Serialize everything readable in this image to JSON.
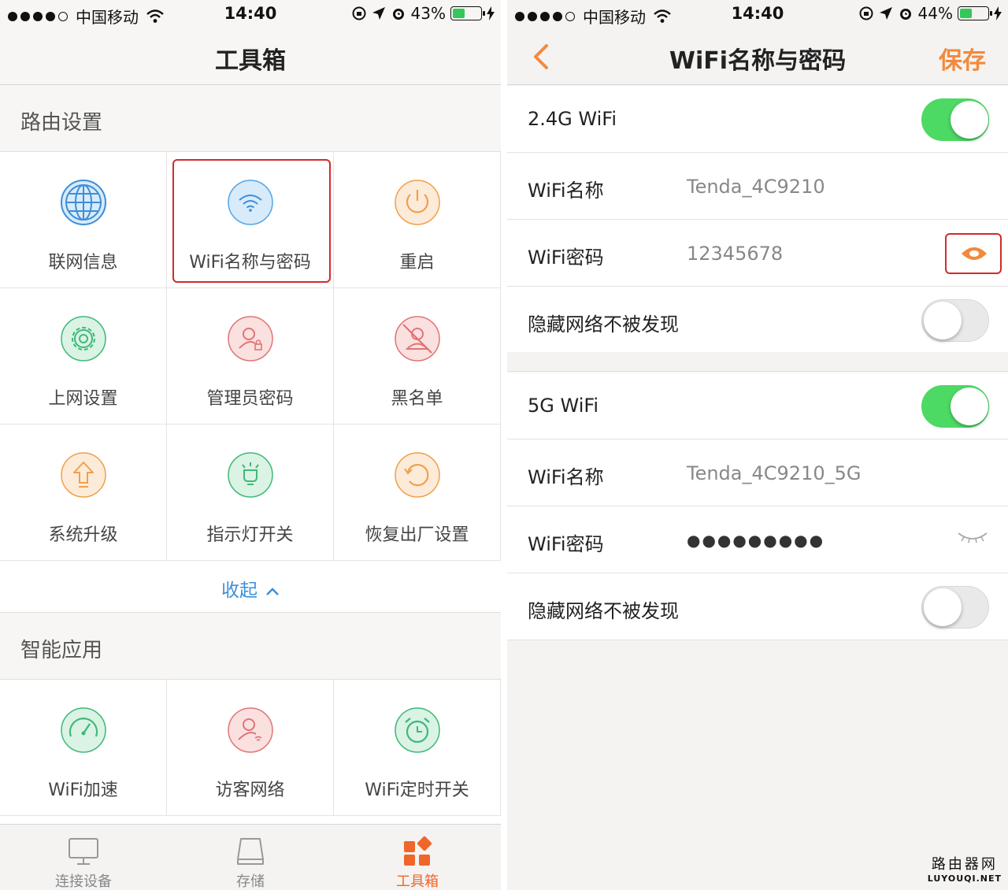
{
  "left": {
    "status": {
      "carrier": "中国移动",
      "time": "14:40",
      "battery": "43%",
      "battery_level": 0.43
    },
    "title": "工具箱",
    "section1": "路由设置",
    "router_items": [
      {
        "label": "联网信息",
        "icon": "globe-icon"
      },
      {
        "label": "WiFi名称与密码",
        "icon": "wifi-icon"
      },
      {
        "label": "重启",
        "icon": "power-icon"
      },
      {
        "label": "上网设置",
        "icon": "gear-icon"
      },
      {
        "label": "管理员密码",
        "icon": "admin-lock-icon"
      },
      {
        "label": "黑名单",
        "icon": "blacklist-icon"
      },
      {
        "label": "系统升级",
        "icon": "upgrade-arrow-icon"
      },
      {
        "label": "指示灯开关",
        "icon": "indicator-light-icon"
      },
      {
        "label": "恢复出厂设置",
        "icon": "reset-icon"
      }
    ],
    "collapse": "收起",
    "section2": "智能应用",
    "smart_items": [
      {
        "label": "WiFi加速",
        "icon": "speedometer-icon"
      },
      {
        "label": "访客网络",
        "icon": "guest-icon"
      },
      {
        "label": "WiFi定时开关",
        "icon": "alarm-clock-icon"
      }
    ],
    "tabs": [
      {
        "label": "连接设备",
        "icon": "monitor-icon"
      },
      {
        "label": "存储",
        "icon": "storage-icon"
      },
      {
        "label": "工具箱",
        "icon": "toolbox-icon"
      }
    ]
  },
  "right": {
    "status": {
      "carrier": "中国移动",
      "time": "14:40",
      "battery": "44%",
      "battery_level": 0.44
    },
    "title": "WiFi名称与密码",
    "save": "保存",
    "band24": {
      "label": "2.4G WiFi",
      "enabled": true,
      "name_label": "WiFi名称",
      "name_value": "Tenda_4C9210",
      "pwd_label": "WiFi密码",
      "pwd_value": "12345678",
      "hide_label": "隐藏网络不被发现",
      "hidden": false
    },
    "band5": {
      "label": "5G WiFi",
      "enabled": true,
      "name_label": "WiFi名称",
      "name_value": "Tenda_4C9210_5G",
      "pwd_label": "WiFi密码",
      "pwd_value": "●●●●●●●●●",
      "hide_label": "隐藏网络不被发现",
      "hidden": false
    }
  },
  "watermark": {
    "line1": "路由器网",
    "line2": "LUYOUQI.NET"
  },
  "colors": {
    "accent_orange": "#f28a3c",
    "toggle_green": "#4cd964",
    "link_blue": "#3a8fd9",
    "highlight_red": "#d12b2b"
  }
}
